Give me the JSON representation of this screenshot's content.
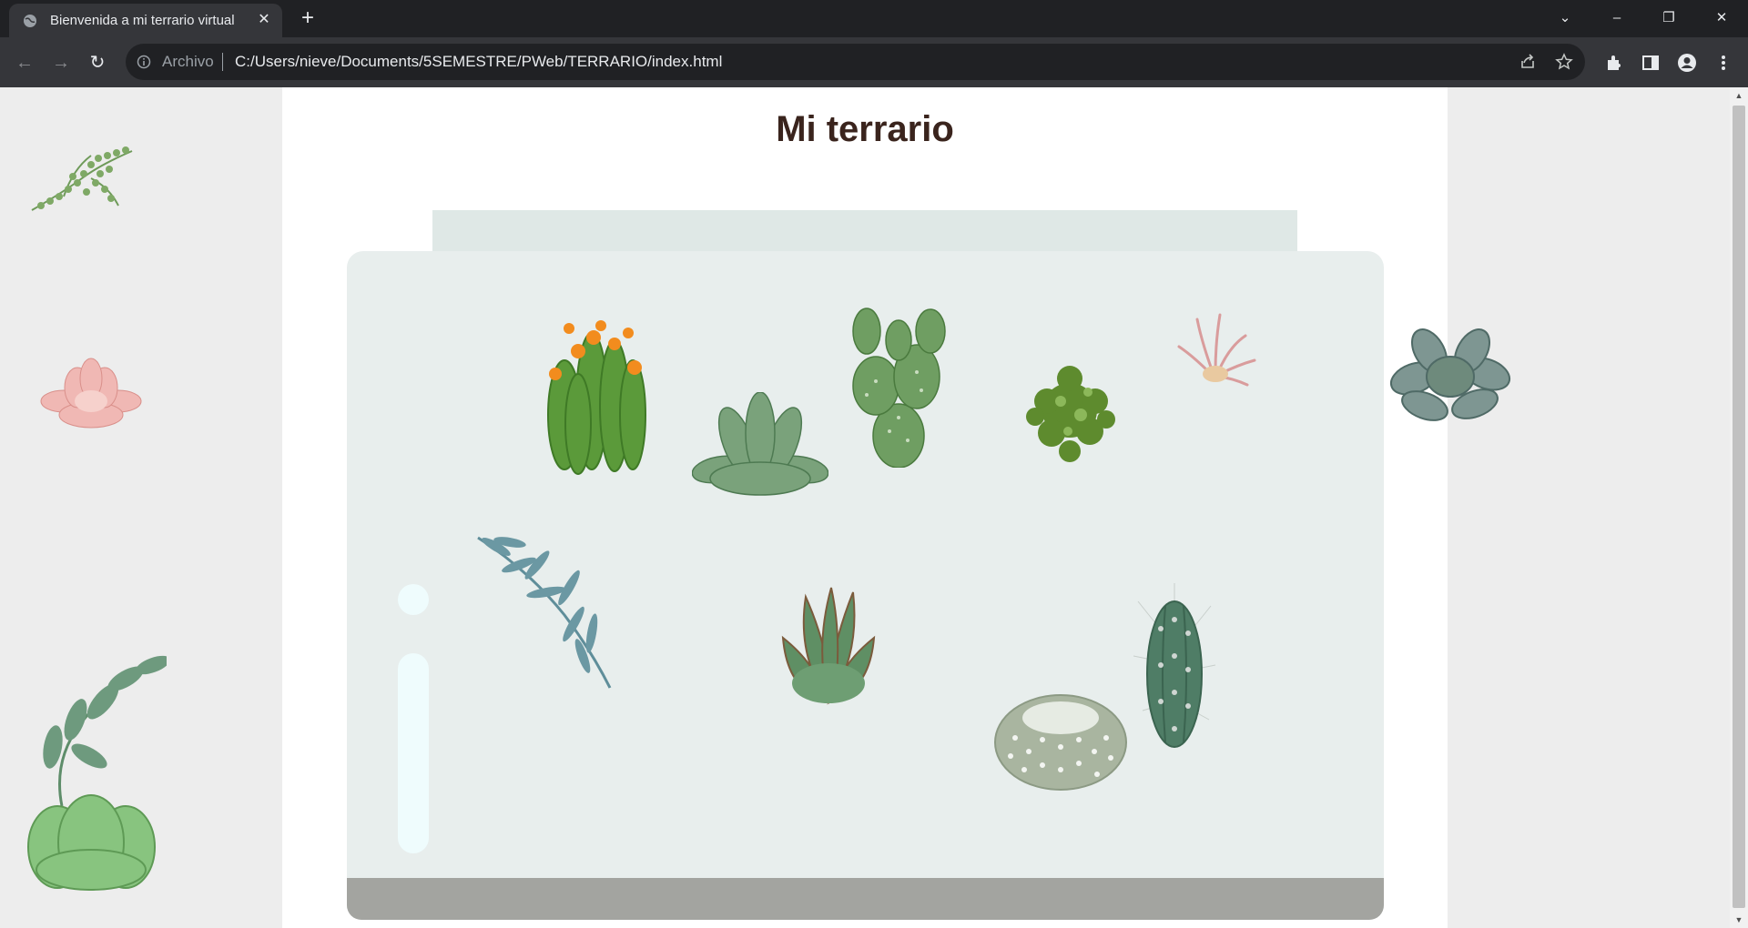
{
  "browser": {
    "tab_title": "Bienvenida a mi terrario virtual",
    "scheme_label": "Archivo",
    "url": "C:/Users/nieve/Documents/5SEMESTRE/PWeb/TERRARIO/index.html"
  },
  "page": {
    "title": "Mi terrario"
  },
  "colors": {
    "chrome_dark": "#202124",
    "chrome_toolbar": "#35363a",
    "side_background": "#ededed",
    "jar_glass": "#e8eeed",
    "jar_base": "#a3a4a0",
    "title_color": "#3a241d"
  },
  "plants": [
    "string-of-pearls",
    "pink-echeveria",
    "leafy-succulent",
    "flowering-cactus",
    "green-rosette",
    "prickly-pear",
    "round-shrub",
    "air-plant",
    "blue-echeveria",
    "eucalyptus-branch",
    "aloe-rosette",
    "column-cactus",
    "ball-cactus"
  ]
}
